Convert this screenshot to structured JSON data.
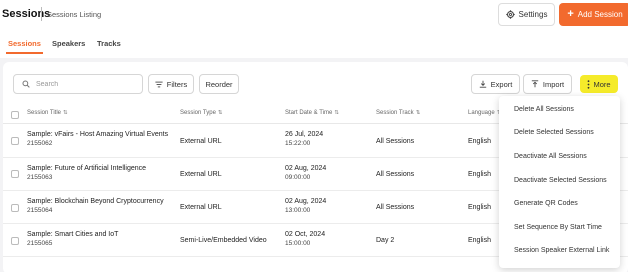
{
  "header": {
    "title": "Sessions",
    "subtitle": "Sessions Listing",
    "settings_label": "Settings",
    "add_label": "Add Session"
  },
  "tabs": [
    {
      "label": "Sessions",
      "active": true
    },
    {
      "label": "Speakers",
      "active": false
    },
    {
      "label": "Tracks",
      "active": false
    }
  ],
  "toolbar": {
    "search_placeholder": "Search",
    "filters_label": "Filters",
    "reorder_label": "Reorder",
    "export_label": "Export",
    "import_label": "Import",
    "more_label": "More"
  },
  "table": {
    "columns": [
      "Session Title",
      "Session Type",
      "Start Date & Time",
      "Session Track",
      "Language"
    ],
    "rows": [
      {
        "title": "Sample: vFairs - Host Amazing Virtual Events",
        "id": "2155062",
        "type": "External URL",
        "date": "26 Jul, 2024",
        "time": "15:22:00",
        "track": "All Sessions",
        "language": "English"
      },
      {
        "title": "Sample: Future of Artificial Intelligence",
        "id": "2155063",
        "type": "External URL",
        "date": "02 Aug, 2024",
        "time": "09:00:00",
        "track": "All Sessions",
        "language": "English"
      },
      {
        "title": "Sample: Blockchain Beyond Cryptocurrency",
        "id": "2155064",
        "type": "External URL",
        "date": "02 Aug, 2024",
        "time": "13:00:00",
        "track": "All Sessions",
        "language": "English"
      },
      {
        "title": "Sample: Smart Cities and IoT",
        "id": "2155065",
        "type": "Semi-Live/Embedded Video",
        "date": "02 Oct, 2024",
        "time": "15:00:00",
        "track": "Day 2",
        "language": "English"
      }
    ]
  },
  "more_menu": {
    "items": [
      "Delete All Sessions",
      "Delete Selected Sessions",
      "Deactivate All Sessions",
      "Deactivate Selected Sessions",
      "Generate QR Codes",
      "Set Sequence By Start Time",
      "Session Speaker External Link"
    ]
  },
  "colors": {
    "accent": "#f26a2e",
    "more_button": "#f5eb2a"
  },
  "icons": {
    "settings": "gear-icon",
    "add": "plus-icon",
    "search": "search-icon",
    "filters": "filter-icon",
    "export": "download-icon",
    "import": "upload-icon",
    "more": "vertical-dots-icon",
    "sort": "sort-icon"
  }
}
